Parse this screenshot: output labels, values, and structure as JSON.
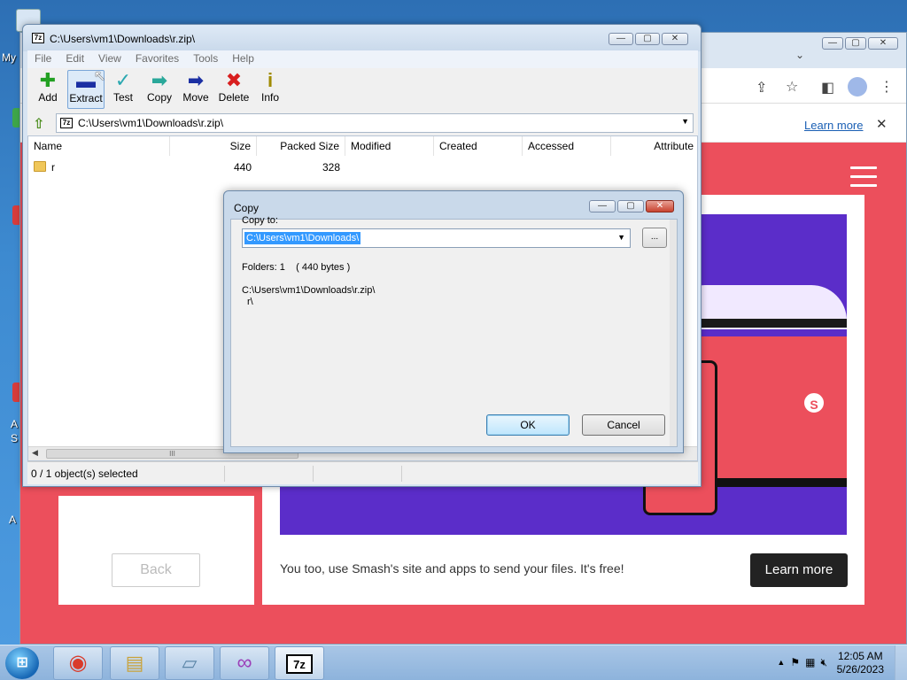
{
  "desktop": {
    "labels": [
      "My",
      "A",
      "S",
      "A"
    ]
  },
  "browser": {
    "info_learn_more": "Learn more",
    "info_close": "✕",
    "back_button": "Back",
    "promo_text": "You too, use Smash's site and apps to send your files. It's free!",
    "learn_more_button": "Learn more",
    "hero_logo": "S",
    "min": "—",
    "max": "▢",
    "close": "✕"
  },
  "sevenzip": {
    "title": "C:\\Users\\vm1\\Downloads\\r.zip\\",
    "app_icon_text": "7z",
    "min": "—",
    "max": "▢",
    "close": "✕",
    "menu": [
      "File",
      "Edit",
      "View",
      "Favorites",
      "Tools",
      "Help"
    ],
    "toolbar": [
      {
        "label": "Add",
        "glyph": "✚",
        "color": "#22a022"
      },
      {
        "label": "Extract",
        "glyph": "▬",
        "color": "#1b2fa3"
      },
      {
        "label": "Test",
        "glyph": "✓",
        "color": "#2aa8b0"
      },
      {
        "label": "Copy",
        "glyph": "➡",
        "color": "#2aa89a"
      },
      {
        "label": "Move",
        "glyph": "➡",
        "color": "#1b2fa3"
      },
      {
        "label": "Delete",
        "glyph": "✖",
        "color": "#d81e1e"
      },
      {
        "label": "Info",
        "glyph": "i",
        "color": "#a08b00"
      }
    ],
    "address": "C:\\Users\\vm1\\Downloads\\r.zip\\",
    "columns": [
      "Name",
      "Size",
      "Packed Size",
      "Modified",
      "Created",
      "Accessed",
      "Attribute"
    ],
    "rows": [
      {
        "name": "r",
        "size": "440",
        "packed": "328"
      }
    ],
    "scroll_thumb": "III",
    "status": "0 / 1 object(s) selected"
  },
  "dialog": {
    "title": "Copy",
    "copy_to_label": "Copy to:",
    "destination": "C:\\Users\\vm1\\Downloads\\",
    "browse": "...",
    "summary": "Folders: 1    ( 440 bytes )",
    "source_path": "C:\\Users\\vm1\\Downloads\\r.zip\\",
    "source_item": "r\\",
    "ok": "OK",
    "cancel": "Cancel"
  },
  "taskbar": {
    "start": "⊞",
    "apps": [
      {
        "name": "chrome-task-button",
        "glyph": "◉",
        "color": "#d93b2b"
      },
      {
        "name": "explorer-task-button",
        "glyph": "▤",
        "color": "#c9a23a"
      },
      {
        "name": "notepad-task-button",
        "glyph": "▱",
        "color": "#5c86a8"
      },
      {
        "name": "infinity-task-button",
        "glyph": "∞",
        "color": "#9b3fb8"
      },
      {
        "name": "sevenzip-task-button",
        "glyph": "7z",
        "color": "#000000"
      }
    ],
    "tray_up": "▲",
    "time": "12:05 AM",
    "date": "5/26/2023"
  }
}
